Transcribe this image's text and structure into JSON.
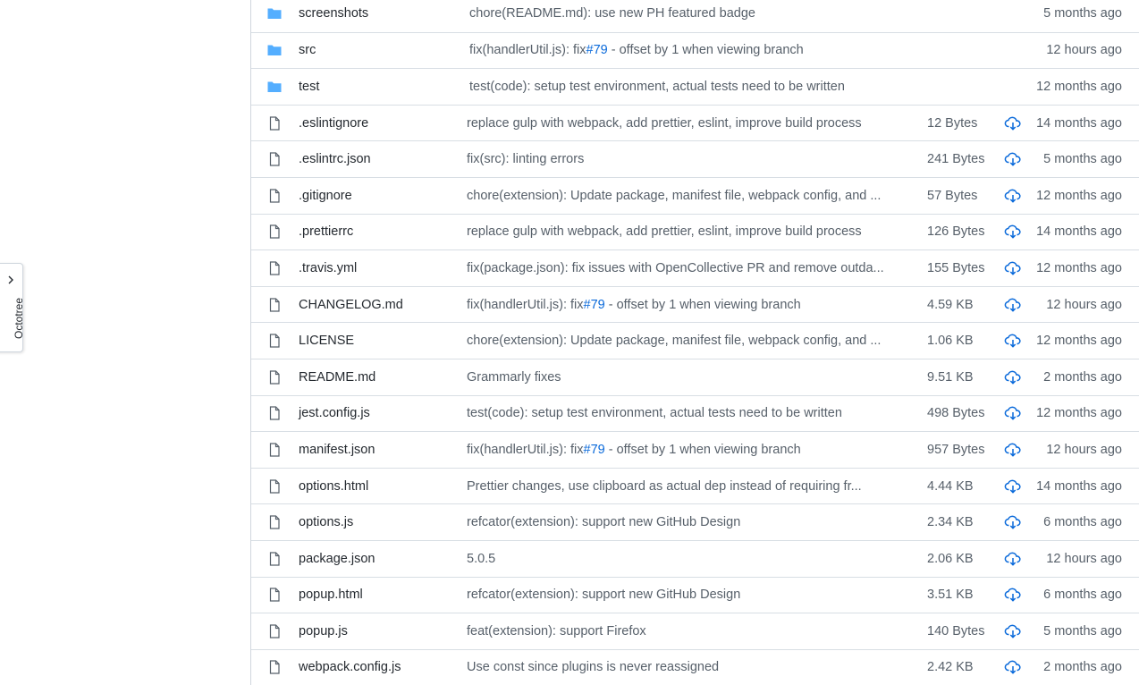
{
  "sidebar": {
    "octotree_label": "Octotree"
  },
  "colors": {
    "folder": "#54aeff",
    "link": "#0969da",
    "download": "#0969da",
    "muted": "#57606a"
  },
  "files": [
    {
      "type": "folder",
      "name": "screenshots",
      "message": "chore(README.md): use new PH featured badge",
      "size": "",
      "age": "5 months ago"
    },
    {
      "type": "folder",
      "name": "src",
      "message_prefix": "fix(handlerUtil.js): ",
      "message_abbr": "fix",
      "message_issue": "#79",
      "message_suffix": " - offset by 1 when viewing branch",
      "size": "",
      "age": "12 hours ago"
    },
    {
      "type": "folder",
      "name": "test",
      "message": "test(code): setup test environment, actual tests need to be written",
      "size": "",
      "age": "12 months ago"
    },
    {
      "type": "file",
      "name": ".eslintignore",
      "message": "replace gulp with webpack, add prettier, eslint, improve build process",
      "size": "12 Bytes",
      "age": "14 months ago"
    },
    {
      "type": "file",
      "name": ".eslintrc.json",
      "message": "fix(src): linting errors",
      "size": "241 Bytes",
      "age": "5 months ago"
    },
    {
      "type": "file",
      "name": ".gitignore",
      "message": "chore(extension): Update package, manifest file, webpack config, and ...",
      "size": "57 Bytes",
      "age": "12 months ago"
    },
    {
      "type": "file",
      "name": ".prettierrc",
      "message": "replace gulp with webpack, add prettier, eslint, improve build process",
      "size": "126 Bytes",
      "age": "14 months ago"
    },
    {
      "type": "file",
      "name": ".travis.yml",
      "message": "fix(package.json): fix issues with OpenCollective PR and remove outda...",
      "size": "155 Bytes",
      "age": "12 months ago"
    },
    {
      "type": "file",
      "name": "CHANGELOG.md",
      "message_prefix": "fix(handlerUtil.js): ",
      "message_abbr": "fix",
      "message_issue": "#79",
      "message_suffix": " - offset by 1 when viewing branch",
      "size": "4.59 KB",
      "age": "12 hours ago"
    },
    {
      "type": "file",
      "name": "LICENSE",
      "message": "chore(extension): Update package, manifest file, webpack config, and ...",
      "size": "1.06 KB",
      "age": "12 months ago"
    },
    {
      "type": "file",
      "name": "README.md",
      "message": "Grammarly fixes",
      "size": "9.51 KB",
      "age": "2 months ago"
    },
    {
      "type": "file",
      "name": "jest.config.js",
      "message": "test(code): setup test environment, actual tests need to be written",
      "size": "498 Bytes",
      "age": "12 months ago"
    },
    {
      "type": "file",
      "name": "manifest.json",
      "message_prefix": "fix(handlerUtil.js): ",
      "message_abbr": "fix",
      "message_issue": "#79",
      "message_suffix": " - offset by 1 when viewing branch",
      "size": "957 Bytes",
      "age": "12 hours ago"
    },
    {
      "type": "file",
      "name": "options.html",
      "message": "Prettier changes, use clipboard as actual dep instead of requiring fr...",
      "size": "4.44 KB",
      "age": "14 months ago"
    },
    {
      "type": "file",
      "name": "options.js",
      "message": "refcator(extension): support new GitHub Design",
      "size": "2.34 KB",
      "age": "6 months ago"
    },
    {
      "type": "file",
      "name": "package.json",
      "message": "5.0.5",
      "size": "2.06 KB",
      "age": "12 hours ago"
    },
    {
      "type": "file",
      "name": "popup.html",
      "message": "refcator(extension): support new GitHub Design",
      "size": "3.51 KB",
      "age": "6 months ago"
    },
    {
      "type": "file",
      "name": "popup.js",
      "message": "feat(extension): support Firefox",
      "size": "140 Bytes",
      "age": "5 months ago"
    },
    {
      "type": "file",
      "name": "webpack.config.js",
      "message": "Use const since plugins is never reassigned",
      "size": "2.42 KB",
      "age": "2 months ago"
    }
  ]
}
